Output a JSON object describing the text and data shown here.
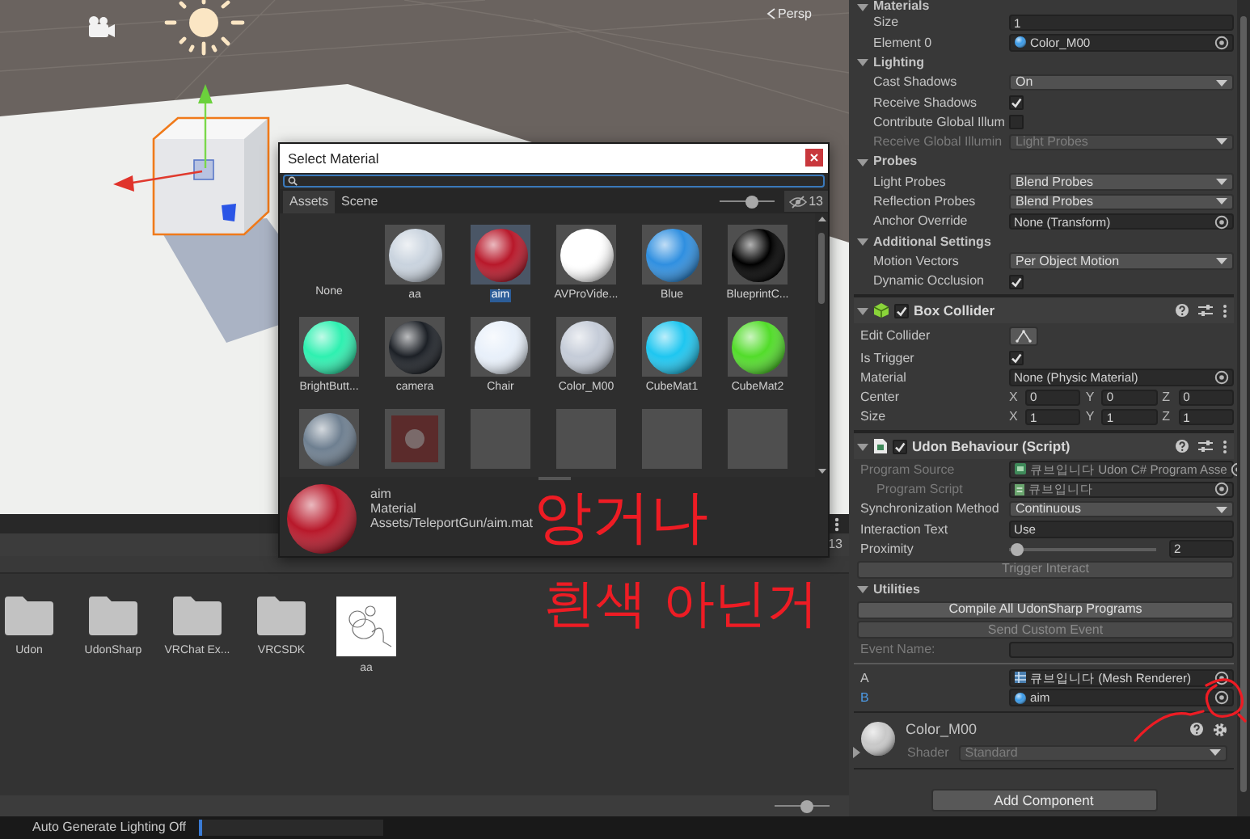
{
  "scene": {
    "view_label": "Persp"
  },
  "dialog": {
    "title": "Select Material",
    "tabs": [
      {
        "label": "Assets",
        "selected": true
      },
      {
        "label": "Scene",
        "selected": false
      }
    ],
    "size_slider": {
      "level": 0.6
    },
    "hidden_count": "13",
    "items": [
      {
        "kind": "none",
        "label": "None",
        "selected": false
      },
      {
        "kind": "sphere",
        "label": "aa",
        "color": "#c9d3de",
        "selected": false
      },
      {
        "kind": "sphere",
        "label": "aim",
        "color": "#b8182a",
        "selected": true
      },
      {
        "kind": "sphere",
        "label": "AVProVide...",
        "color": "#ffffff",
        "selected": false
      },
      {
        "kind": "sphere",
        "label": "Blue",
        "color": "#2f8fe0",
        "selected": false
      },
      {
        "kind": "sphere",
        "label": "BlueprintC...",
        "color": "#000000",
        "selected": false
      },
      {
        "kind": "sphere",
        "label": "BrightButt...",
        "color": "#2ef0b0",
        "selected": false
      },
      {
        "kind": "sphere",
        "label": "camera",
        "color": "#1c2026",
        "selected": false
      },
      {
        "kind": "sphere",
        "label": "Chair",
        "color": "#e8f0fa",
        "selected": false
      },
      {
        "kind": "sphere",
        "label": "Color_M00",
        "color": "#c5ccd8",
        "selected": false
      },
      {
        "kind": "sphere",
        "label": "CubeMat1",
        "color": "#1ec6f0",
        "selected": false
      },
      {
        "kind": "sphere",
        "label": "CubeMat2",
        "color": "#52dc2a",
        "selected": false
      },
      {
        "kind": "sphere",
        "color": "#6e7f90",
        "selected": false
      },
      {
        "kind": "texture",
        "color": "#5b2b2b",
        "selected": false
      },
      {
        "kind": "blank",
        "selected": false
      },
      {
        "kind": "blank",
        "selected": false
      },
      {
        "kind": "blank",
        "selected": false
      },
      {
        "kind": "blank",
        "selected": false
      }
    ],
    "preview": {
      "name": "aim",
      "type": "Material",
      "path": "Assets/TeleportGun/aim.mat"
    }
  },
  "project": {
    "tab_count": "13",
    "items": [
      {
        "kind": "folder",
        "label": "Udon"
      },
      {
        "kind": "folder",
        "label": "UdonSharp"
      },
      {
        "kind": "folder",
        "label": "VRChat Ex..."
      },
      {
        "kind": "folder",
        "label": "VRCSDK"
      },
      {
        "label": "aa"
      }
    ],
    "zoom_slider": {
      "level": 0.6
    }
  },
  "inspector": {
    "sections": [
      {
        "kind": "plain",
        "rows": [
          {
            "kind": "header",
            "label": "Materials",
            "expanded": true
          },
          {
            "kind": "field",
            "label": "Size",
            "value": "1",
            "disabled": false
          },
          {
            "kind": "matfield",
            "label": "Element 0",
            "value": "Color_M00",
            "disabled": false
          },
          {
            "kind": "header",
            "label": "Lighting",
            "expanded": true
          },
          {
            "kind": "dropdown",
            "label": "Cast Shadows",
            "value": "On",
            "disabled": false
          },
          {
            "kind": "checkbox",
            "label": "Receive Shadows",
            "checked": true,
            "disabled": false
          },
          {
            "kind": "checkbox",
            "label": "Contribute Global Illum",
            "checked": false,
            "disabled": false
          },
          {
            "kind": "dropdown",
            "label": "Receive Global Illumin",
            "value": "Light Probes",
            "disabled": true
          },
          {
            "kind": "header",
            "label": "Probes",
            "expanded": true
          },
          {
            "kind": "dropdown",
            "label": "Light Probes",
            "value": "Blend Probes",
            "disabled": false
          },
          {
            "kind": "dropdown",
            "label": "Reflection Probes",
            "value": "Blend Probes",
            "disabled": false
          },
          {
            "kind": "objfield",
            "label": "Anchor Override",
            "value": "None (Transform)",
            "disabled": false
          },
          {
            "kind": "header",
            "label": "Additional Settings",
            "expanded": true
          },
          {
            "kind": "dropdown",
            "label": "Motion Vectors",
            "value": "Per Object Motion",
            "disabled": false
          },
          {
            "kind": "checkbox",
            "label": "Dynamic Occlusion",
            "checked": true,
            "disabled": false
          }
        ]
      },
      {
        "kind": "collider",
        "title": "Box Collider",
        "enabled": true,
        "expanded": true,
        "rows": [
          {
            "kind": "edit",
            "label": "Edit Collider",
            "disabled": false
          },
          {
            "kind": "checkbox",
            "label": "Is Trigger",
            "checked": true,
            "disabled": false
          },
          {
            "kind": "objfield",
            "label": "Material",
            "value": "None (Physic Material)",
            "disabled": false
          },
          {
            "kind": "vector",
            "label": "Center",
            "disabled": false,
            "axes": [
              {
                "axis": "X",
                "value": "0"
              },
              {
                "axis": "Y",
                "value": "0"
              },
              {
                "axis": "Z",
                "value": "0"
              }
            ]
          },
          {
            "kind": "vector",
            "label": "Size",
            "disabled": false,
            "axes": [
              {
                "axis": "X",
                "value": "1"
              },
              {
                "axis": "Y",
                "value": "1"
              },
              {
                "axis": "Z",
                "value": "1"
              }
            ]
          }
        ]
      },
      {
        "kind": "script",
        "title": "Udon Behaviour (Script)",
        "enabled": true,
        "expanded": true,
        "rows": [
          {
            "kind": "assetfield",
            "label": "Program Source",
            "value": "큐브입니다 Udon C# Program Asse",
            "disabled": true,
            "children": [
              {
                "kind": "scriptfield",
                "label": "Program Script",
                "value": "큐브입니다",
                "disabled": true
              }
            ]
          },
          {
            "kind": "dropdown",
            "label": "Synchronization Method",
            "value": "Continuous",
            "disabled": false
          },
          {
            "kind": "field",
            "label": "Interaction Text",
            "value": "Use",
            "disabled": false
          },
          {
            "kind": "slider",
            "label": "Proximity",
            "level": 0.02,
            "value": "2",
            "disabled": false
          },
          {
            "kind": "button",
            "label": "Trigger Interact",
            "disabled": true
          },
          {
            "kind": "header",
            "label": "Utilities",
            "expanded": true
          },
          {
            "kind": "button",
            "label": "Compile All UdonSharp Programs",
            "disabled": false
          },
          {
            "kind": "button",
            "label": "Send Custom Event",
            "disabled": true
          },
          {
            "kind": "field",
            "label": "Event Name:",
            "disabled": true
          }
        ],
        "variables": [
          {
            "kind": "meshfield",
            "label": "A",
            "value": "큐브입니다 (Mesh Renderer)",
            "highlighted": false
          },
          {
            "kind": "matfield",
            "label": "B",
            "value": "aim",
            "highlighted": true
          }
        ]
      },
      {
        "kind": "material",
        "title": "Color_M00",
        "shader_label": "Shader",
        "shader": "Standard",
        "expanded": false
      }
    ],
    "add_component": "Add Component"
  },
  "status_bar": {
    "text": "Auto Generate Lighting Off",
    "level": 0.02
  },
  "annotations": [
    {
      "text": "앙거나"
    },
    {
      "text": "흰색 아닌거"
    }
  ]
}
